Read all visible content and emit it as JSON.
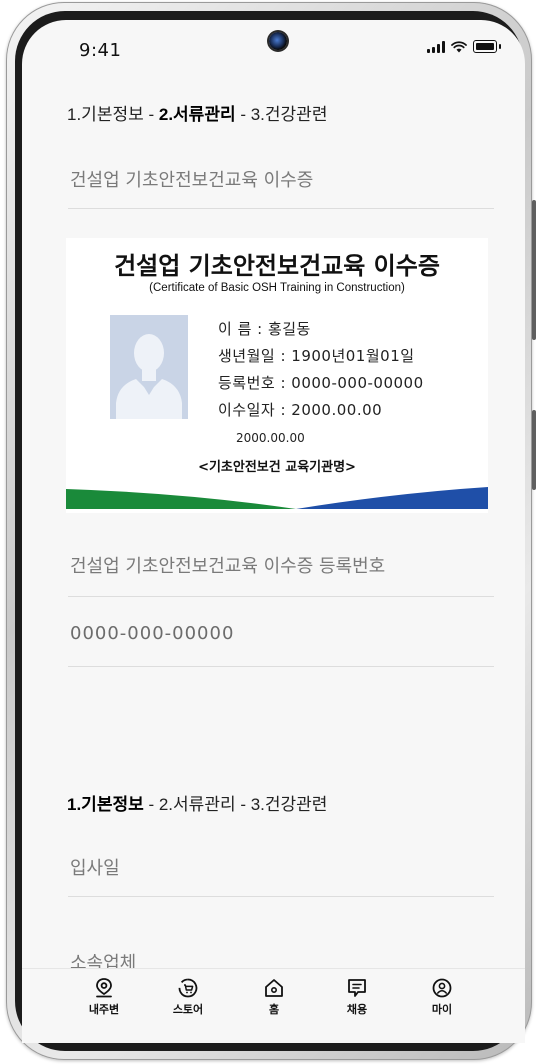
{
  "status_bar": {
    "time": "9:41"
  },
  "section1": {
    "steps": {
      "part1": "1.기본정보 - ",
      "part2": "2.서류관리",
      "part3": " - 3.건강관련"
    },
    "cert_field_label": "건설업 기초안전보건교육 이수증",
    "certificate": {
      "title": "건설업 기초안전보건교육 이수증",
      "subtitle": "(Certificate of Basic OSH Training in Construction)",
      "rows": [
        "이      름 : 홍길동",
        "생년월일 : 1900년01월01일",
        "등록번호 : 0000-000-00000",
        "이수일자 : 2000.00.00"
      ],
      "issue_date": "2000.00.00",
      "org_name": "<기초안전보건 교육기관명>",
      "band_colors": {
        "green": "#1a8a3a",
        "blue": "#1f4fa8"
      }
    },
    "reg_label": "건설업 기초안전보건교육 이수증 등록번호",
    "reg_value": "0000-000-00000"
  },
  "section2": {
    "steps": {
      "part1": "1.기본정보",
      "part2": " - 2.서류관리 - 3.건강관련"
    },
    "hire_date_label": "입사일",
    "company_label": "소속업체"
  },
  "nav": {
    "items": [
      {
        "label": "내주변",
        "icon": "location-pin-icon"
      },
      {
        "label": "스토어",
        "icon": "cart-icon"
      },
      {
        "label": "홈",
        "icon": "home-icon"
      },
      {
        "label": "채용",
        "icon": "chat-icon"
      },
      {
        "label": "마이",
        "icon": "user-icon"
      }
    ]
  }
}
